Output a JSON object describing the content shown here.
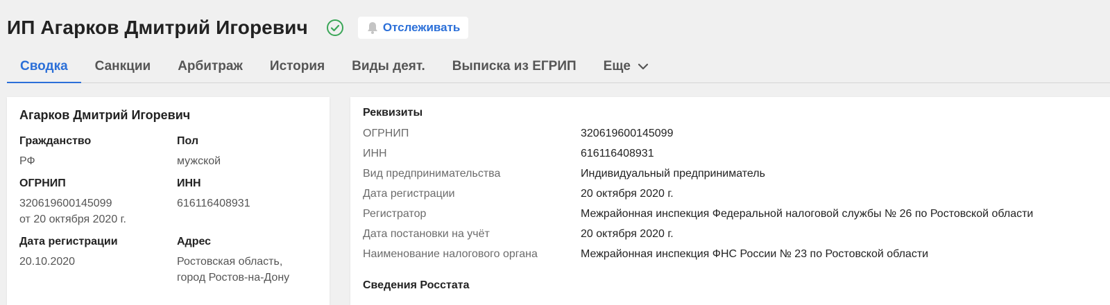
{
  "header": {
    "title": "ИП Агарков Дмитрий Игоревич",
    "track_label": "Отслеживать"
  },
  "tabs": [
    {
      "label": "Сводка",
      "active": true
    },
    {
      "label": "Санкции"
    },
    {
      "label": "Арбитраж"
    },
    {
      "label": "История"
    },
    {
      "label": "Виды деят."
    },
    {
      "label": "Выписка из ЕГРИП"
    },
    {
      "label": "Еще"
    }
  ],
  "summary": {
    "name": "Агарков Дмитрий Игоревич",
    "citizenship_label": "Гражданство",
    "citizenship_value": "РФ",
    "gender_label": "Пол",
    "gender_value": "мужской",
    "ogrnip_label": "ОГРНИП",
    "ogrnip_value": "320619600145099",
    "ogrnip_date": "от 20 октября 2020 г.",
    "inn_label": "ИНН",
    "inn_value": "616116408931",
    "regdate_label": "Дата регистрации",
    "regdate_value": "20.10.2020",
    "address_label": "Адрес",
    "address_line1": "Ростовская область,",
    "address_line2": "город Ростов-на-Дону"
  },
  "requisites": {
    "title": "Реквизиты",
    "rows": [
      {
        "label": "ОГРНИП",
        "value": "320619600145099"
      },
      {
        "label": "ИНН",
        "value": "616116408931"
      },
      {
        "label": "Вид предпринимательства",
        "value": "Индивидуальный предприниматель"
      },
      {
        "label": "Дата регистрации",
        "value": "20 октября 2020 г."
      },
      {
        "label": "Регистратор",
        "value": "Межрайонная инспекция Федеральной налоговой службы № 26 по Ростовской области"
      },
      {
        "label": "Дата постановки на учёт",
        "value": "20 октября 2020 г."
      },
      {
        "label": "Наименование налогового органа",
        "value": "Межрайонная инспекция ФНС России № 23 по Ростовской области"
      }
    ]
  },
  "rosstat": {
    "title": "Сведения Росстата"
  },
  "colors": {
    "accent": "#2b6fd8",
    "verified": "#3aa657",
    "background": "#f0f0f0"
  }
}
